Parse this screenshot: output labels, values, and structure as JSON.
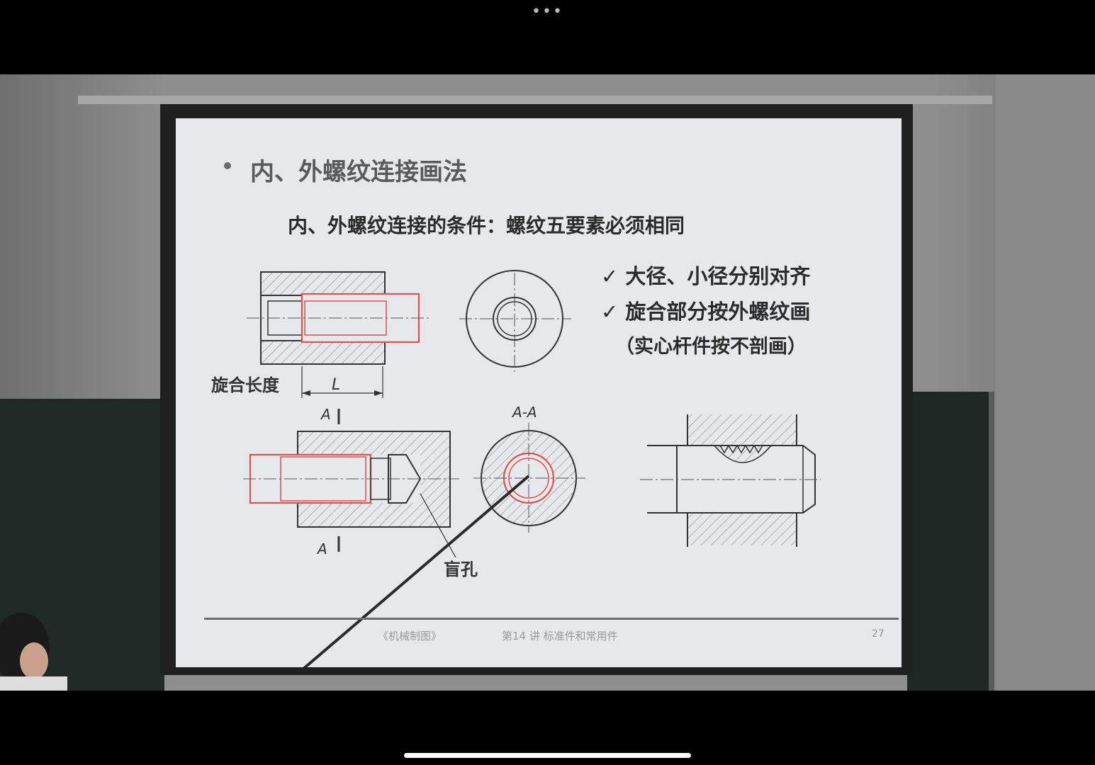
{
  "slide": {
    "title": "内、外螺纹连接画法",
    "subtitle": "内、外螺纹连接的条件：螺纹五要素必须相同",
    "check_items": [
      "✓  大径、小径分别对齐",
      "✓  旋合部分按外螺纹画"
    ],
    "note": "（实心杆件按不剖画）",
    "labels": {
      "engagement_length": "旋合长度",
      "length_symbol": "L",
      "section_mark_top": "A",
      "section_mark_bottom": "A",
      "section_title": "A-A",
      "blind_hole": "盲孔"
    },
    "footer": {
      "course": "《机械制图》",
      "lecture": "第14 讲  标准件和常用件",
      "page_number": "27"
    }
  },
  "colors": {
    "thread_red": "#d9534f",
    "line_dark": "#333333",
    "slide_bg": "#e6e8eb"
  }
}
